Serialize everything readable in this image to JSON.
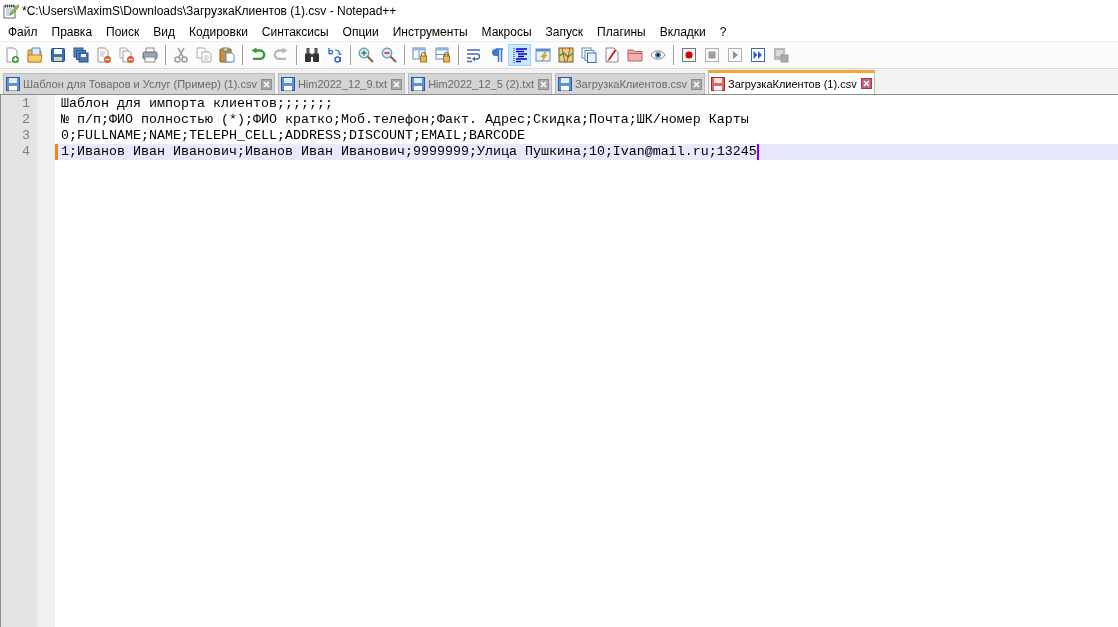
{
  "window": {
    "title": "*C:\\Users\\MaximS\\Downloads\\ЗагрузкаКлиентов (1).csv - Notepad++"
  },
  "menu": [
    "Файл",
    "Правка",
    "Поиск",
    "Вид",
    "Кодировки",
    "Синтаксисы",
    "Опции",
    "Инструменты",
    "Макросы",
    "Запуск",
    "Плагины",
    "Вкладки",
    "?"
  ],
  "toolbar": {
    "groups": [
      [
        {
          "pressed": false,
          "disabled": false
        },
        {
          "pressed": false,
          "disabled": false
        },
        {
          "pressed": false,
          "disabled": false
        },
        {
          "pressed": false,
          "disabled": false
        },
        {
          "pressed": false,
          "disabled": false
        },
        {
          "pressed": false,
          "disabled": false
        },
        {
          "pressed": false,
          "disabled": false
        }
      ],
      [
        {
          "pressed": false,
          "disabled": true
        },
        {
          "pressed": false,
          "disabled": true
        },
        {
          "pressed": false,
          "disabled": false
        }
      ],
      [
        {
          "pressed": false,
          "disabled": false
        },
        {
          "pressed": false,
          "disabled": true
        }
      ],
      [
        {
          "pressed": false,
          "disabled": false
        },
        {
          "pressed": false,
          "disabled": false
        }
      ],
      [
        {
          "pressed": false,
          "disabled": false
        },
        {
          "pressed": false,
          "disabled": false
        }
      ],
      [
        {
          "pressed": false,
          "disabled": false
        },
        {
          "pressed": false,
          "disabled": false
        }
      ],
      [
        {
          "pressed": false,
          "disabled": false
        },
        {
          "pressed": false,
          "disabled": false
        },
        {
          "pressed": true,
          "disabled": false
        },
        {
          "pressed": false,
          "disabled": false
        },
        {
          "pressed": false,
          "disabled": false
        },
        {
          "pressed": false,
          "disabled": false
        },
        {
          "pressed": false,
          "disabled": false
        },
        {
          "pressed": false,
          "disabled": false
        },
        {
          "pressed": false,
          "disabled": false
        }
      ],
      [
        {
          "pressed": false,
          "disabled": false
        },
        {
          "pressed": false,
          "disabled": true
        },
        {
          "pressed": false,
          "disabled": true
        },
        {
          "pressed": false,
          "disabled": false
        },
        {
          "pressed": false,
          "disabled": true
        }
      ]
    ]
  },
  "tabs": [
    {
      "label": "Шаблон для Товаров и Услуг (Пример) (1).csv",
      "selected": false,
      "modified": false
    },
    {
      "label": "Him2022_12_9.txt",
      "selected": false,
      "modified": false
    },
    {
      "label": "Him2022_12_5 (2).txt",
      "selected": false,
      "modified": false
    },
    {
      "label": "ЗагрузкаКлиентов.csv",
      "selected": false,
      "modified": false
    },
    {
      "label": "ЗагрузкаКлиентов (1).csv",
      "selected": true,
      "modified": true
    }
  ],
  "editor": {
    "lines": [
      {
        "number": "1",
        "text": "Шаблон для импорта клиентов;;;;;;;",
        "current": false,
        "changed": false
      },
      {
        "number": "2",
        "text": "№ п/п;ФИО полностью (*);ФИО кратко;Моб.телефон;Факт. Адрес;Скидка;Почта;ШК/номер Карты",
        "current": false,
        "changed": false
      },
      {
        "number": "3",
        "text": "0;FULLNAME;NAME;TELEPH_CELL;ADDRESS;DISCOUNT;EMAIL;BARCODE",
        "current": false,
        "changed": false
      },
      {
        "number": "4",
        "text": "1;Иванов Иван Иванович;Иванов Иван Иванович;9999999;Улица Пушкина;10;Ivan@mail.ru;13245",
        "current": true,
        "changed": true
      }
    ]
  }
}
